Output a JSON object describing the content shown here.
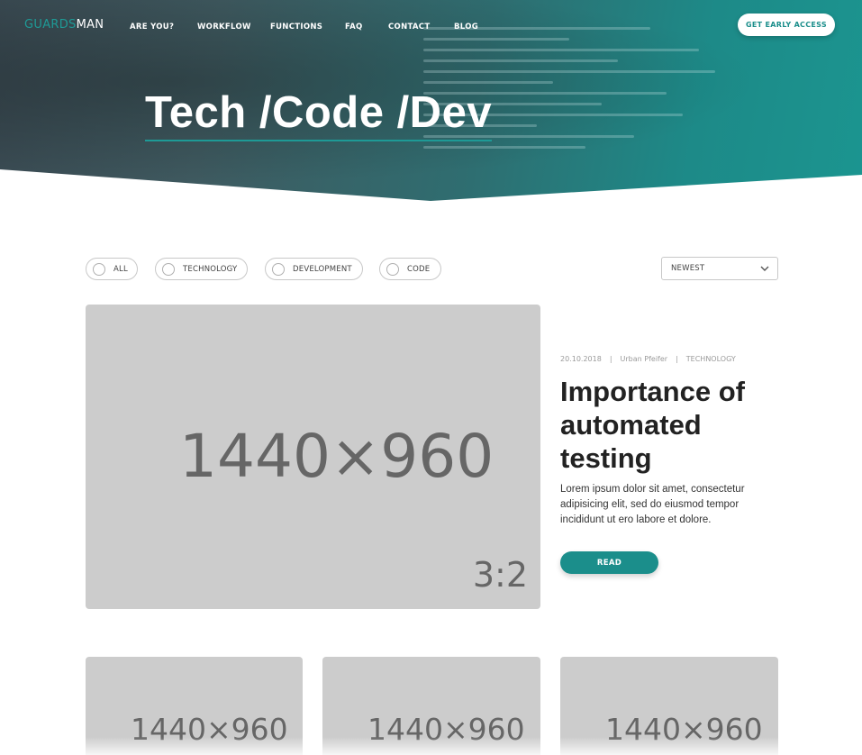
{
  "brand": {
    "part1": "GUARDS",
    "part2": "MAN"
  },
  "nav": [
    {
      "label": "ARE YOU?"
    },
    {
      "label": "WORKFLOW"
    },
    {
      "label": "FUNCTIONS"
    },
    {
      "label": "FAQ"
    },
    {
      "label": "CONTACT"
    },
    {
      "label": "BLOG"
    }
  ],
  "cta": {
    "label": "GET EARLY ACCESS"
  },
  "hero": {
    "title": "Tech /Code /Dev"
  },
  "filters": [
    {
      "label": "ALL"
    },
    {
      "label": "TECHNOLOGY"
    },
    {
      "label": "DEVELOPMENT"
    },
    {
      "label": "CODE"
    }
  ],
  "sort": {
    "selected": "NEWEST",
    "icon": "chevron-down-icon"
  },
  "featured": {
    "image": {
      "size_text": "1440×960",
      "ratio_text": "3:2"
    },
    "date": "20.10.2018",
    "author": "Urban Pfeifer",
    "category": "TECHNOLOGY",
    "title": "Importance of automated testing",
    "excerpt": "Lorem ipsum dolor sit amet, consectetur adipisicing elit, sed do eiusmod tempor incididunt ut ero labore et dolore.",
    "read_label": "READ"
  },
  "cards": [
    {
      "size_text": "1440×960"
    },
    {
      "size_text": "1440×960"
    },
    {
      "size_text": "1440×960"
    }
  ],
  "colors": {
    "accent": "#1b8e8b",
    "placeholder": "#cccccc"
  }
}
